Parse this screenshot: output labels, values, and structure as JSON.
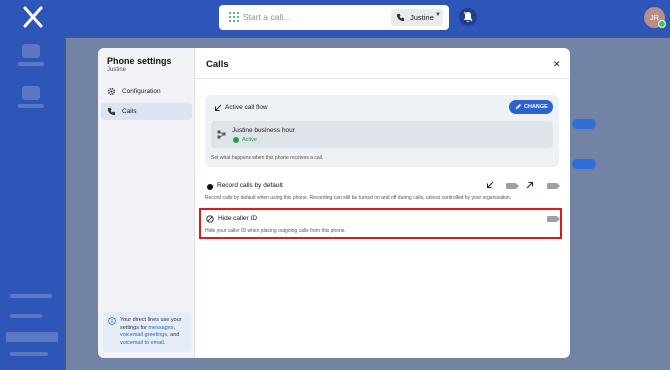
{
  "topbar": {
    "search_placeholder": "Start a call...",
    "line_selector": "Justine",
    "avatar_initials": "JR"
  },
  "modal": {
    "sidebar": {
      "title": "Phone settings",
      "subtitle": "Justine",
      "items": [
        {
          "label": "Configuration",
          "icon": "gear-icon",
          "active": false
        },
        {
          "label": "Calls",
          "icon": "phone-icon",
          "active": true
        }
      ],
      "info": {
        "text_1": "Your direct lines use your settings for ",
        "link_messages": "messages",
        "text_2": ", ",
        "link_greetings": "voicemail greetings",
        "text_3": ", and ",
        "link_email": "voicemail to email",
        "text_4": "."
      }
    },
    "title": "Calls",
    "call_flow": {
      "title": "Active call flow",
      "change_label": "CHANGE",
      "flow_name": "Justine business hour",
      "status": "Active",
      "help": "Set what happens when this phone receives a call."
    },
    "record_calls": {
      "label": "Record calls by default",
      "help": "Record calls by default when using this phone. Recording can still be turned on and off during calls, unless controlled by your organisation.",
      "inbound_enabled": false,
      "outbound_enabled": false
    },
    "hide_caller_id": {
      "label": "Hide caller ID",
      "help": "Hide your caller ID when placing outgoing calls from this phone.",
      "enabled": false
    }
  },
  "colors": {
    "brand_blue": "#2e56b8",
    "button_blue": "#2b63d2",
    "active_green": "#2e9c47",
    "highlight_red": "#e01a1a"
  }
}
